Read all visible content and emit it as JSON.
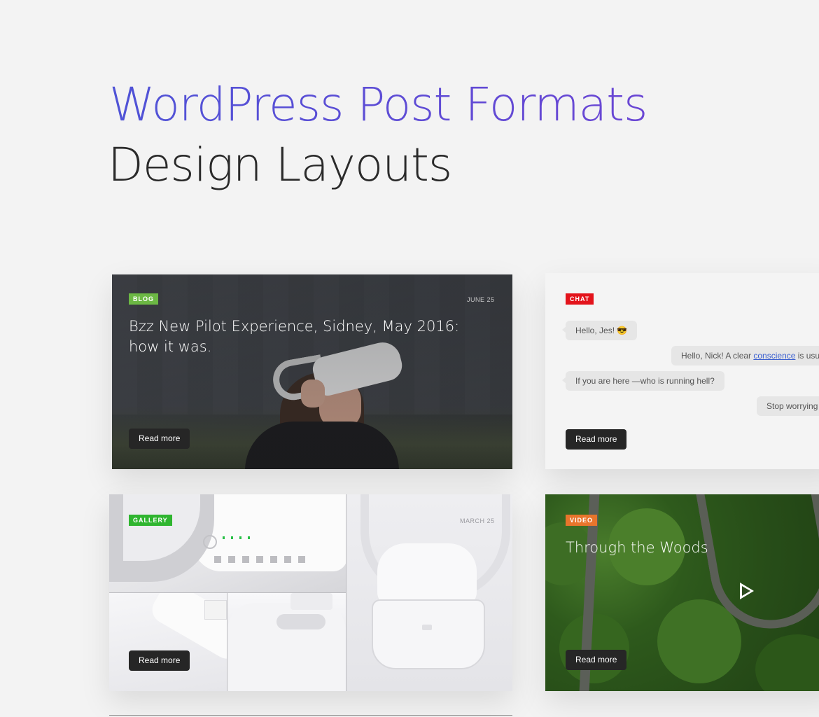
{
  "hero": {
    "title_line1": "WordPress Post Formats",
    "title_line2": "Design Layouts",
    "gradient_start": "#4f53d6",
    "gradient_end": "#6a46d4"
  },
  "cards": {
    "blog": {
      "tag": "BLOG",
      "tag_color": "#6cb844",
      "date": "JUNE 25",
      "title_line1": "Bzz New Pilot Experience, Sidney, May 2016:",
      "title_line2": "how it was.",
      "button": "Read more"
    },
    "chat": {
      "tag": "CHAT",
      "tag_color": "#e3131b",
      "messages": [
        {
          "side": "left",
          "text": "Hello, Jes! 😎"
        },
        {
          "side": "right",
          "text_before": "Hello, Nick! A clear ",
          "link": "conscience",
          "text_after": " is usually"
        },
        {
          "side": "left",
          "text": "If you are here —who is running hell?"
        },
        {
          "side": "right",
          "text": "Stop worrying ab"
        }
      ],
      "button": "Read more"
    },
    "gallery": {
      "tag": "GALLERY",
      "tag_color": "#2fb52f",
      "date": "MARCH 25",
      "button": "Read more"
    },
    "video": {
      "tag": "VIDEO",
      "tag_color": "#e8752c",
      "title": "Through the Woods",
      "button": "Read more"
    }
  }
}
